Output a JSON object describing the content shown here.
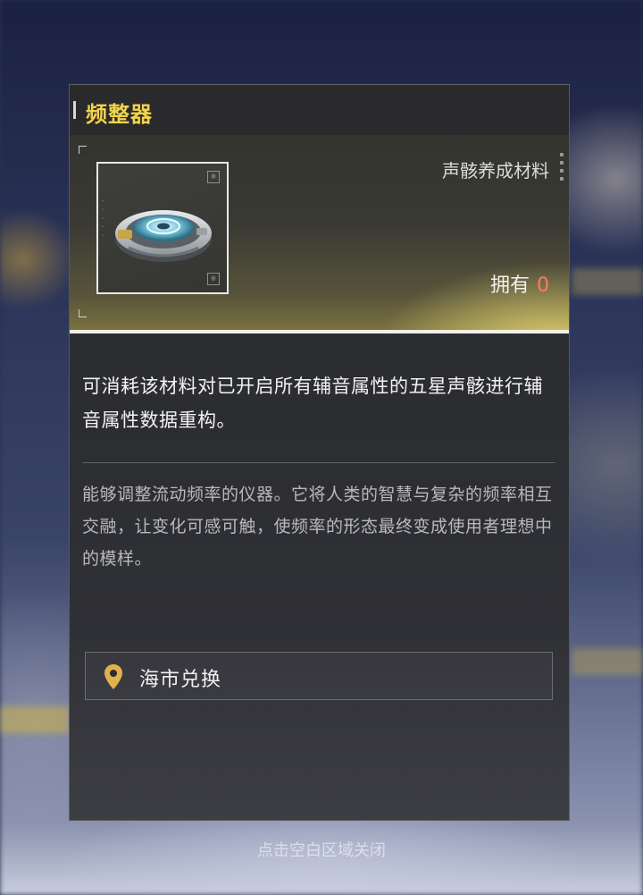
{
  "item": {
    "title": "频整器",
    "category": "声骸养成材料",
    "owned_label": "拥有",
    "owned_count": "0",
    "description": "可消耗该材料对已开启所有辅音属性的五星声骸进行辅音属性数据重构。",
    "lore": "能够调整流动频率的仪器。它将人类的智慧与复杂的频率相互交融，让变化可感可触，使频率的形态最终变成使用者理想中的模样。"
  },
  "source": {
    "label": "海市兑换",
    "icon": "location-pin-icon"
  },
  "footer": {
    "close_hint": "点击空白区域关闭"
  },
  "colors": {
    "title": "#f1d44c",
    "count": "#ff7a5e",
    "pin": "#e2b24a"
  }
}
